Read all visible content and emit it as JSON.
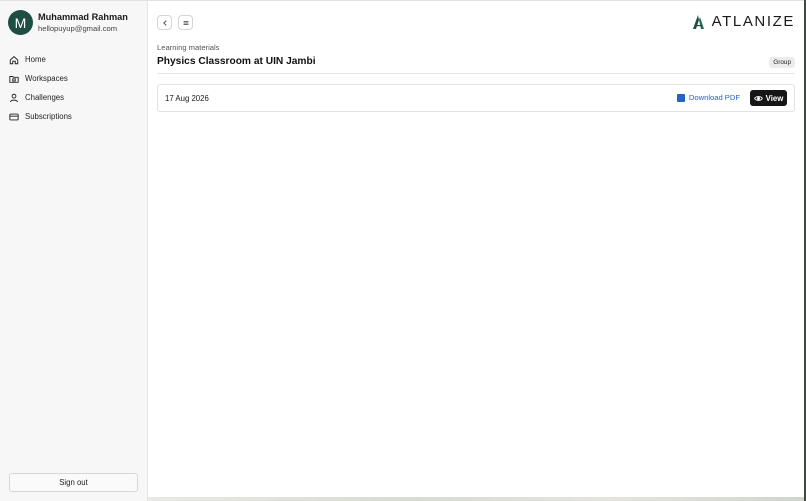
{
  "user": {
    "initial": "M",
    "name": "Muhammad Rahman",
    "email": "hellopuyup@gmail.com",
    "avatar_color": "#1f4d43"
  },
  "sidebar": {
    "items": [
      {
        "label": "Home",
        "icon": "home-icon"
      },
      {
        "label": "Workspaces",
        "icon": "folder-icon"
      },
      {
        "label": "Challenges",
        "icon": "user-icon"
      },
      {
        "label": "Subscriptions",
        "icon": "credit-card-icon"
      }
    ],
    "sign_out": "Sign out"
  },
  "toolbar": {
    "back_icon": "chevron-left-icon",
    "menu_icon": "menu-icon"
  },
  "brand": {
    "name": "ATLANIZE",
    "color": "#1f4d43"
  },
  "page": {
    "section_label": "Learning materials",
    "title": "Physics Classroom at UIN Jambi",
    "badge": "Group"
  },
  "materials": [
    {
      "date": "17 Aug 2026",
      "download_label": "Download PDF",
      "view_label": "View"
    }
  ],
  "colors": {
    "link": "#2563c9",
    "primary_button": "#161616"
  }
}
